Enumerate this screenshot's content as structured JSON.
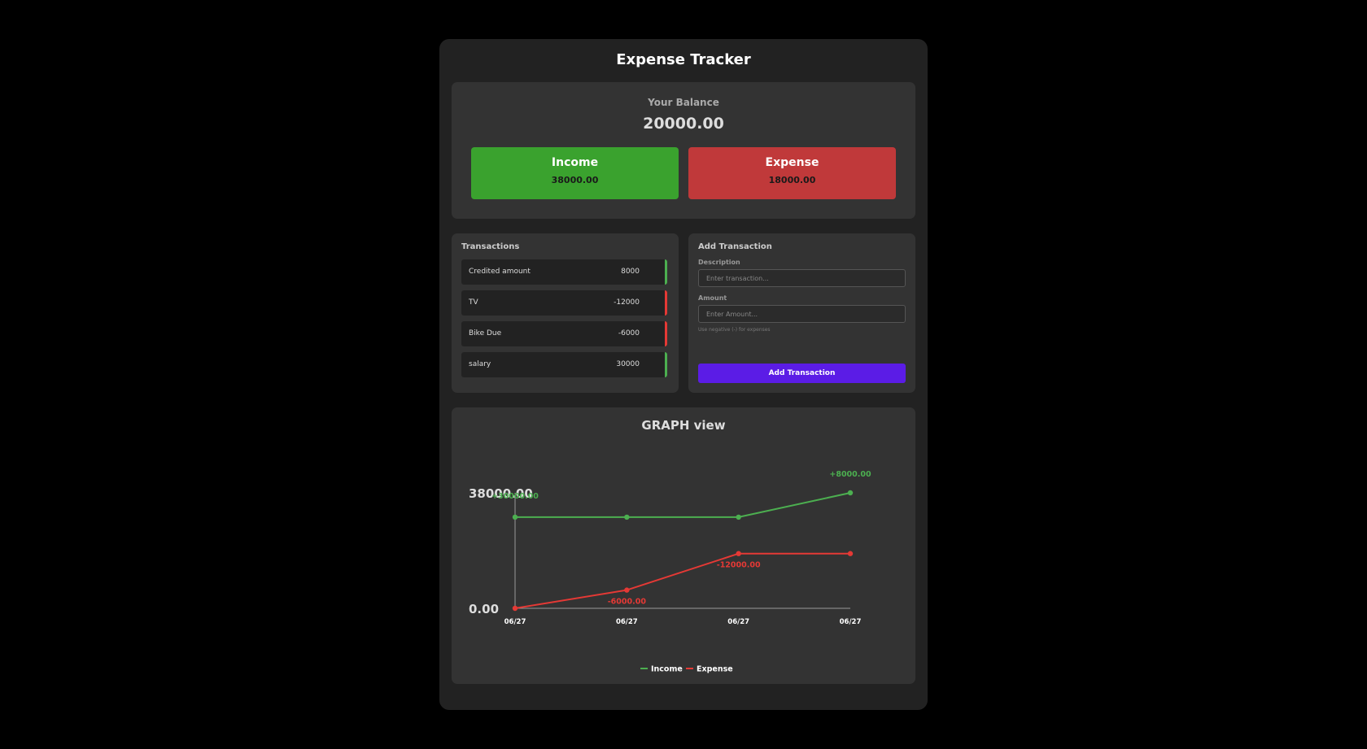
{
  "app": {
    "title": "Expense Tracker"
  },
  "balance": {
    "label": "Your Balance",
    "value": "20000.00"
  },
  "summary": {
    "income": {
      "label": "Income",
      "value": "38000.00",
      "color": "#3aa22e"
    },
    "expense": {
      "label": "Expense",
      "value": "18000.00",
      "color": "#c0393a"
    }
  },
  "transactions": {
    "heading": "Transactions",
    "items": [
      {
        "name": "Credited amount",
        "amount": "8000",
        "kind": "income"
      },
      {
        "name": "TV",
        "amount": "-12000",
        "kind": "expense"
      },
      {
        "name": "Bike Due",
        "amount": "-6000",
        "kind": "expense"
      },
      {
        "name": "salary",
        "amount": "30000",
        "kind": "income"
      }
    ]
  },
  "add_form": {
    "heading": "Add Transaction",
    "description_label": "Description",
    "description_placeholder": "Enter transaction...",
    "description_value": "",
    "amount_label": "Amount",
    "amount_placeholder": "Enter Amount...",
    "amount_value": "",
    "hint": "Use negative (-) for expenses",
    "submit_label": "Add Transaction",
    "submit_color": "#5b1ce6"
  },
  "graph": {
    "title": "GRAPH view"
  },
  "chart_data": {
    "type": "line",
    "x": [
      "06/27",
      "06/27",
      "06/27",
      "06/27"
    ],
    "y_tick_labels": [
      "0.00",
      "38000.00"
    ],
    "ylim": [
      0,
      38000
    ],
    "series": [
      {
        "name": "Income",
        "color": "#4caf50",
        "values": [
          30000,
          30000,
          30000,
          38000
        ],
        "point_labels": [
          "+30000.00",
          "",
          "",
          "+8000.00"
        ]
      },
      {
        "name": "Expense",
        "color": "#e53935",
        "values": [
          0,
          6000,
          18000,
          18000
        ],
        "point_labels": [
          "",
          "-6000.00",
          "-12000.00",
          ""
        ]
      }
    ],
    "legend": "bottom",
    "grid": false
  }
}
